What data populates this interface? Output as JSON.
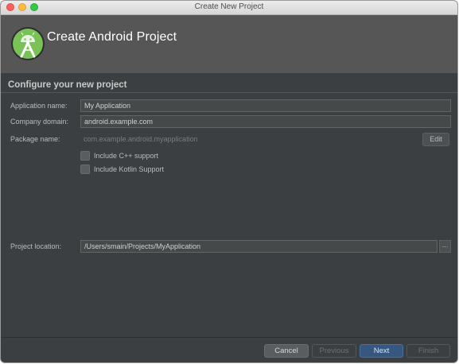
{
  "window": {
    "title": "Create New Project"
  },
  "header": {
    "title": "Create Android Project",
    "logo_icon": "android-studio-logo-icon"
  },
  "section": {
    "title": "Configure your new project"
  },
  "form": {
    "app_name_label": "Application name:",
    "app_name_value": "My Application",
    "company_domain_label": "Company domain:",
    "company_domain_value": "android.example.com",
    "package_name_label": "Package name:",
    "package_name_value": "com.example.android.myapplication",
    "edit_label": "Edit",
    "cpp_support_label": "Include C++ support",
    "cpp_support_checked": false,
    "kotlin_support_label": "Include Kotlin Support",
    "kotlin_support_checked": false,
    "project_location_label": "Project location:",
    "project_location_value": "/Users/smain/Projects/MyApplication",
    "browse_label": "..."
  },
  "footer": {
    "cancel_label": "Cancel",
    "previous_label": "Previous",
    "next_label": "Next",
    "finish_label": "Finish"
  },
  "colors": {
    "dialog_bg": "#3c3f41",
    "banner_bg": "#565656",
    "accent_green": "#3ddc84",
    "primary_button": "#365880"
  }
}
